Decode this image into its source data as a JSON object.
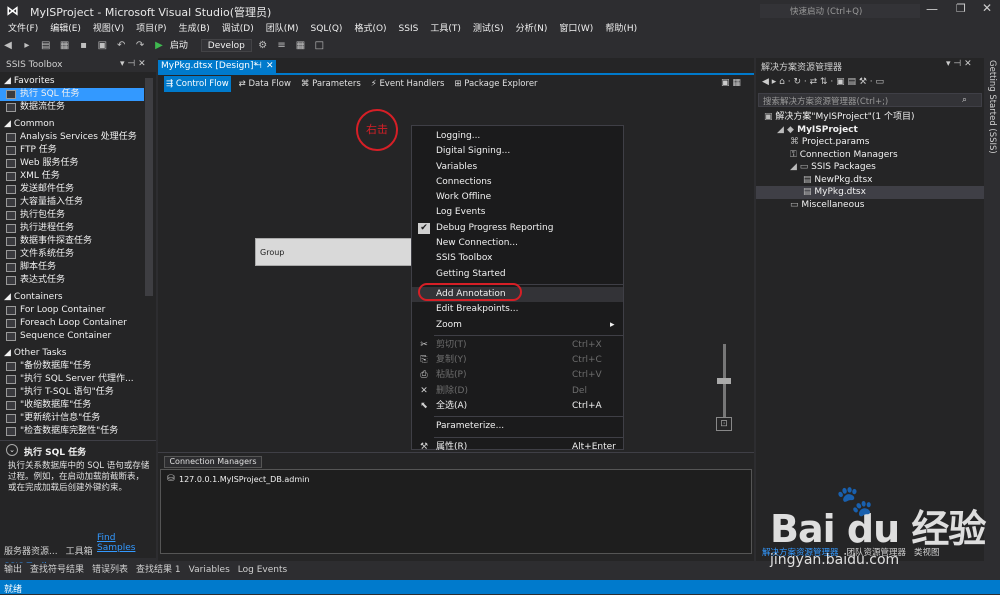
{
  "window": {
    "title": "MyISProject - Microsoft Visual Studio(管理员)",
    "quick_launch": "快速启动 (Ctrl+Q)"
  },
  "menu": [
    "文件(F)",
    "编辑(E)",
    "视图(V)",
    "项目(P)",
    "生成(B)",
    "调试(D)",
    "团队(M)",
    "SQL(Q)",
    "格式(O)",
    "SSIS",
    "工具(T)",
    "测试(S)",
    "分析(N)",
    "窗口(W)",
    "帮助(H)"
  ],
  "toolbar": {
    "start_label": "启动",
    "config_value": "Develop"
  },
  "toolbox": {
    "title": "SSIS Toolbox",
    "groups": [
      {
        "name": "Favorites",
        "items": [
          "执行 SQL 任务",
          "数据流任务"
        ]
      },
      {
        "name": "Common",
        "items": [
          "Analysis Services 处理任务",
          "FTP 任务",
          "Web 服务任务",
          "XML 任务",
          "发送邮件任务",
          "大容量插入任务",
          "执行包任务",
          "执行进程任务",
          "数据事件探查任务",
          "文件系统任务",
          "脚本任务",
          "表达式任务"
        ]
      },
      {
        "name": "Containers",
        "items": [
          "For Loop Container",
          "Foreach Loop Container",
          "Sequence Container"
        ]
      },
      {
        "name": "Other Tasks",
        "items": [
          "\"备份数据库\"任务",
          "\"执行 SQL Server 代理作...",
          "\"执行 T-SQL 语句\"任务",
          "\"收缩数据库\"任务",
          "\"更新统计信息\"任务",
          "\"检查数据库完整性\"任务"
        ]
      }
    ],
    "description_title": "执行 SQL 任务",
    "description_text": "执行关系数据库中的 SQL 语句或存储过程。例如，在启动加载前截断表，或在完成加载后创建外键约束。",
    "find_samples": "Find Samples",
    "bottom_tabs": [
      "服务器资源...",
      "工具箱",
      "SSIS Toolb..."
    ]
  },
  "designer": {
    "tab_label": "MyPkg.dtsx [Design]*",
    "subtabs": [
      "Control Flow",
      "Data Flow",
      "Parameters",
      "Event Handlers",
      "Package Explorer"
    ],
    "annotation": "右击",
    "group_label": "Group",
    "conn_tab": "Connection Managers",
    "conn_item": "127.0.0.1.MyISProject_DB.admin"
  },
  "context_menu": {
    "items": [
      {
        "label": "Logging...",
        "shortcut": "",
        "disabled": false
      },
      {
        "label": "Digital Signing...",
        "shortcut": "",
        "disabled": false
      },
      {
        "label": "Variables",
        "shortcut": "",
        "disabled": false
      },
      {
        "label": "Connections",
        "shortcut": "",
        "disabled": false
      },
      {
        "label": "Work Offline",
        "shortcut": "",
        "disabled": false
      },
      {
        "label": "Log Events",
        "shortcut": "",
        "disabled": false
      },
      {
        "label": "Debug Progress Reporting",
        "shortcut": "",
        "disabled": false,
        "checked": true
      },
      {
        "label": "New Connection...",
        "shortcut": "",
        "disabled": false
      },
      {
        "label": "SSIS Toolbox",
        "shortcut": "",
        "disabled": false
      },
      {
        "label": "Getting Started",
        "shortcut": "",
        "disabled": false
      },
      {
        "label": "Add Annotation",
        "shortcut": "",
        "disabled": false,
        "highlight": true
      },
      {
        "label": "Edit Breakpoints...",
        "shortcut": "",
        "disabled": false
      },
      {
        "label": "Zoom",
        "shortcut": "",
        "disabled": false,
        "submenu": true
      },
      {
        "label": "剪切(T)",
        "shortcut": "Ctrl+X",
        "disabled": true
      },
      {
        "label": "复制(Y)",
        "shortcut": "Ctrl+C",
        "disabled": true
      },
      {
        "label": "粘贴(P)",
        "shortcut": "Ctrl+V",
        "disabled": true
      },
      {
        "label": "删除(D)",
        "shortcut": "Del",
        "disabled": true
      },
      {
        "label": "全选(A)",
        "shortcut": "Ctrl+A",
        "disabled": false
      },
      {
        "label": "Parameterize...",
        "shortcut": "",
        "disabled": false
      },
      {
        "label": "属性(R)",
        "shortcut": "Alt+Enter",
        "disabled": false
      }
    ]
  },
  "solution": {
    "title": "解决方案资源管理器",
    "search_placeholder": "搜索解决方案资源管理器(Ctrl+;)",
    "tree": [
      {
        "label": "解决方案\"MyISProject\"(1 个项目)",
        "level": 0
      },
      {
        "label": "MyISProject",
        "level": 1,
        "bold": true
      },
      {
        "label": "Project.params",
        "level": 2
      },
      {
        "label": "Connection Managers",
        "level": 2
      },
      {
        "label": "SSIS Packages",
        "level": 2
      },
      {
        "label": "NewPkg.dtsx",
        "level": 3
      },
      {
        "label": "MyPkg.dtsx",
        "level": 3,
        "selected": true
      },
      {
        "label": "Miscellaneous",
        "level": 2
      }
    ],
    "bottom_tabs": [
      "解决方案资源管理器",
      "团队资源管理器",
      "类视图"
    ],
    "side_tab": "Getting Started (SSIS)"
  },
  "output_tabs": [
    "输出",
    "查找符号结果",
    "错误列表",
    "查找结果 1",
    "Variables",
    "Log Events"
  ],
  "status": "就绪",
  "watermark": {
    "brand": "Bai du 经验",
    "url": "jingyan.baidu.com"
  }
}
